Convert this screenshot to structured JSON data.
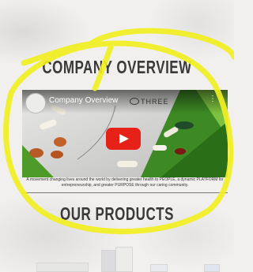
{
  "sections": {
    "overview_heading": "COMPANY OVERVIEW",
    "products_heading": "OUR PRODUCTS"
  },
  "video": {
    "title": "Company Overview",
    "brand": "THREE",
    "caption": "A movement changing lives around the world by delivering greater health to PEOPLE, a dynamic PLATFORM for entrepreneurship, and greater PURPOSE through our caring community."
  },
  "colors": {
    "play_button": "#e62117",
    "annotation": "#f2ef22",
    "accent_green": "#4e9b2a"
  }
}
